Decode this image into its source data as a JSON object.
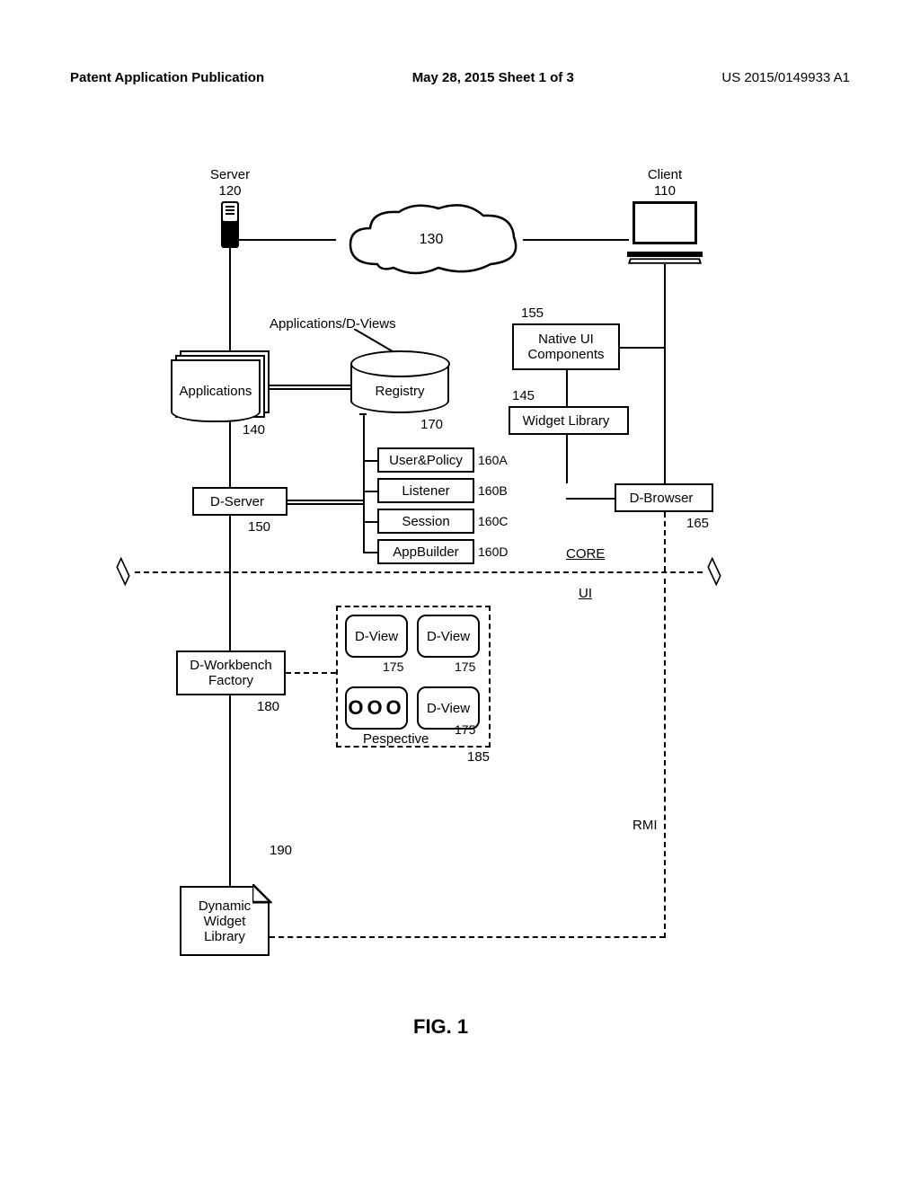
{
  "header": {
    "left": "Patent Application Publication",
    "center": "May 28, 2015  Sheet 1 of 3",
    "right": "US 2015/0149933 A1"
  },
  "figure_label": "FIG. 1",
  "nodes": {
    "server_label": "Server",
    "server_ref": "120",
    "client_label": "Client",
    "client_ref": "110",
    "cloud_ref": "130",
    "apps_d_views": "Applications/D-Views",
    "native_ui": "Native UI\nComponents",
    "native_ui_ref": "155",
    "applications": "Applications",
    "applications_ref": "140",
    "registry": "Registry",
    "registry_ref": "170",
    "widget_library": "Widget Library",
    "widget_library_ref": "145",
    "user_policy": "User&Policy",
    "user_policy_ref": "160A",
    "listener": "Listener",
    "listener_ref": "160B",
    "session": "Session",
    "session_ref": "160C",
    "app_builder": "AppBuilder",
    "app_builder_ref": "160D",
    "d_server": "D-Server",
    "d_server_ref": "150",
    "d_browser": "D-Browser",
    "d_browser_ref": "165",
    "core_label": "CORE",
    "ui_label": "UI",
    "d_workbench": "D-Workbench\nFactory",
    "d_workbench_ref": "180",
    "d_view": "D-View",
    "d_view_ref": "175",
    "perspective": "Pespective",
    "perspective_ref": "185",
    "dots": "OOO",
    "rmi": "RMI",
    "dyn_widget_lib": "Dynamic\nWidget\nLibrary",
    "dyn_widget_lib_ref": "190"
  }
}
